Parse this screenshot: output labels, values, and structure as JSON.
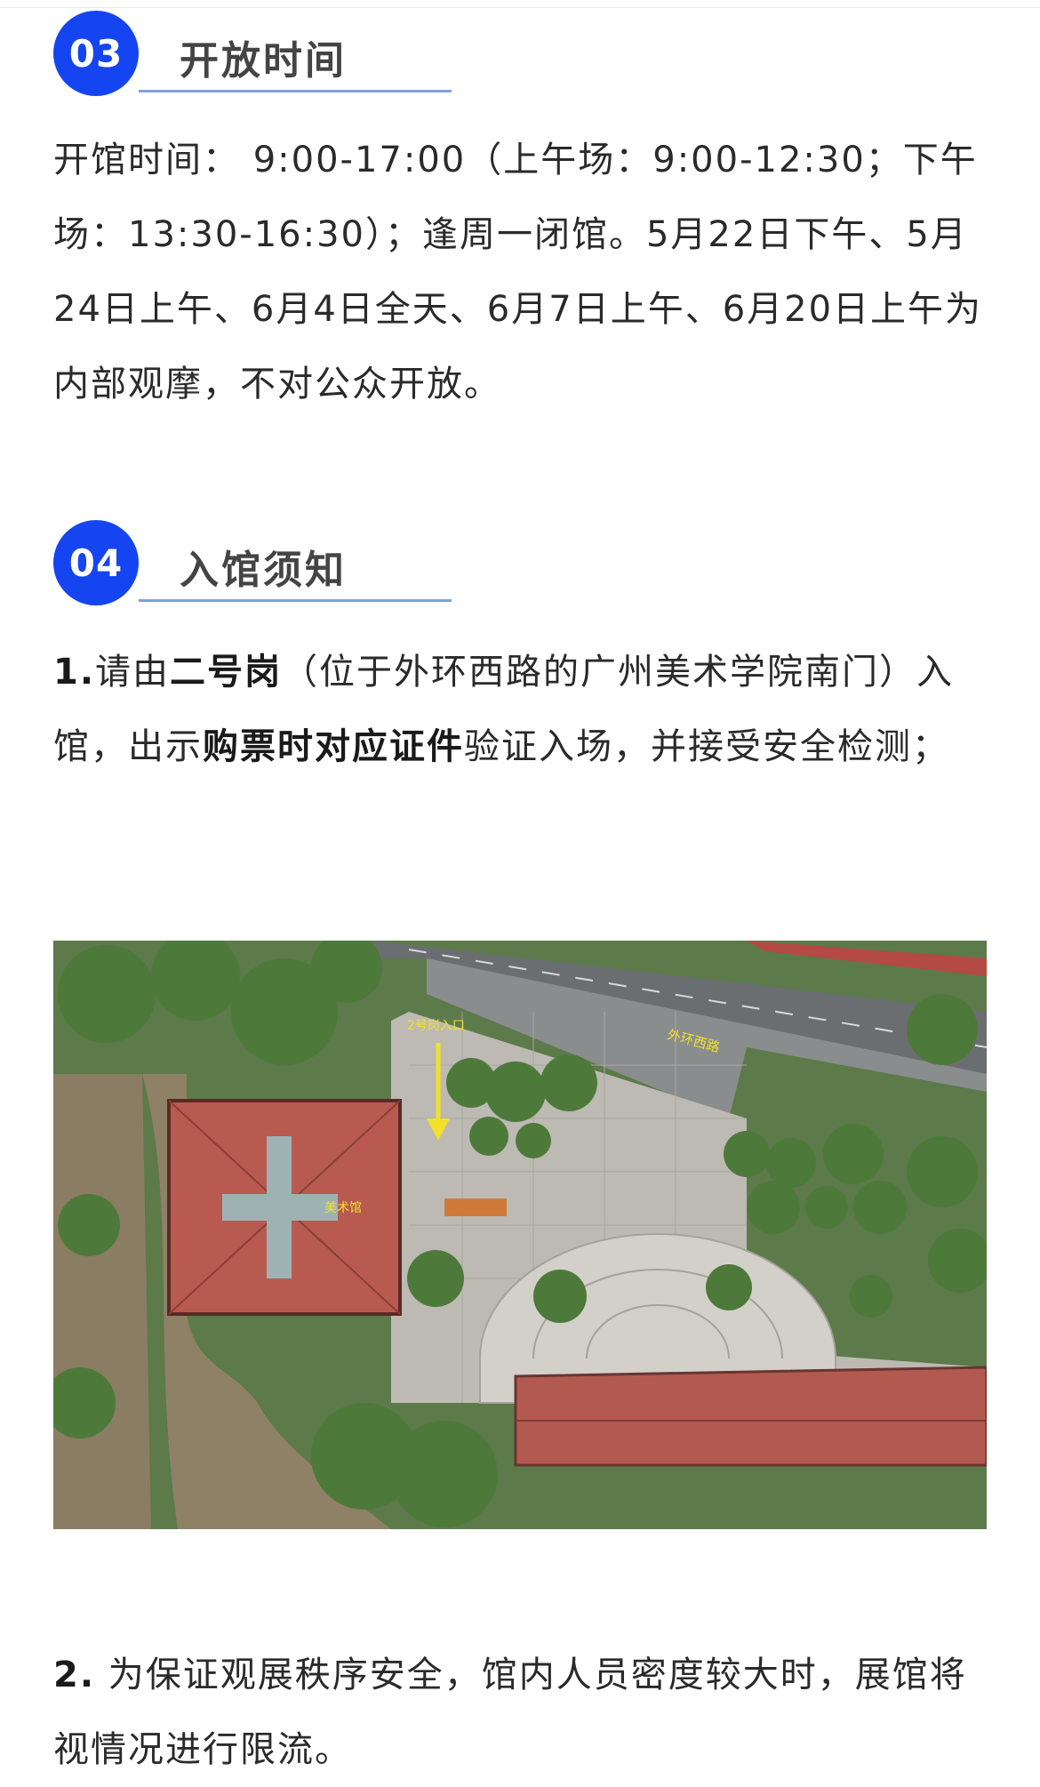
{
  "section3": {
    "number": "03",
    "title": "开放时间",
    "body": "开馆时间： 9:00-17:00（上午场：9:00-12:30；下午场：13:30-16:30）；逢周一闭馆。5月22日下午、5月24日上午、6月4日全天、6月7日上午、6月20日上午为内部观摩，不对公众开放。"
  },
  "section4": {
    "number": "04",
    "title": "入馆须知",
    "item1": {
      "num": "1.",
      "t1": "请由",
      "b1": "二号岗",
      "t2": "（位于外环西路的广州美术学院南门）入馆，出示",
      "b2": "购票时对应证件",
      "t3": "验证入场，并接受安全检测；"
    },
    "map": {
      "entrance_label": "2号岗入口",
      "road_label": "外环西路",
      "building_label": "美术馆"
    },
    "item2": {
      "num": "2.",
      "text": "为保证观展秩序安全，馆内人员密度较大时，展馆将视情况进行限流。"
    }
  },
  "colors": {
    "badge": "#1545f0",
    "underline": "#7aa2d6"
  }
}
